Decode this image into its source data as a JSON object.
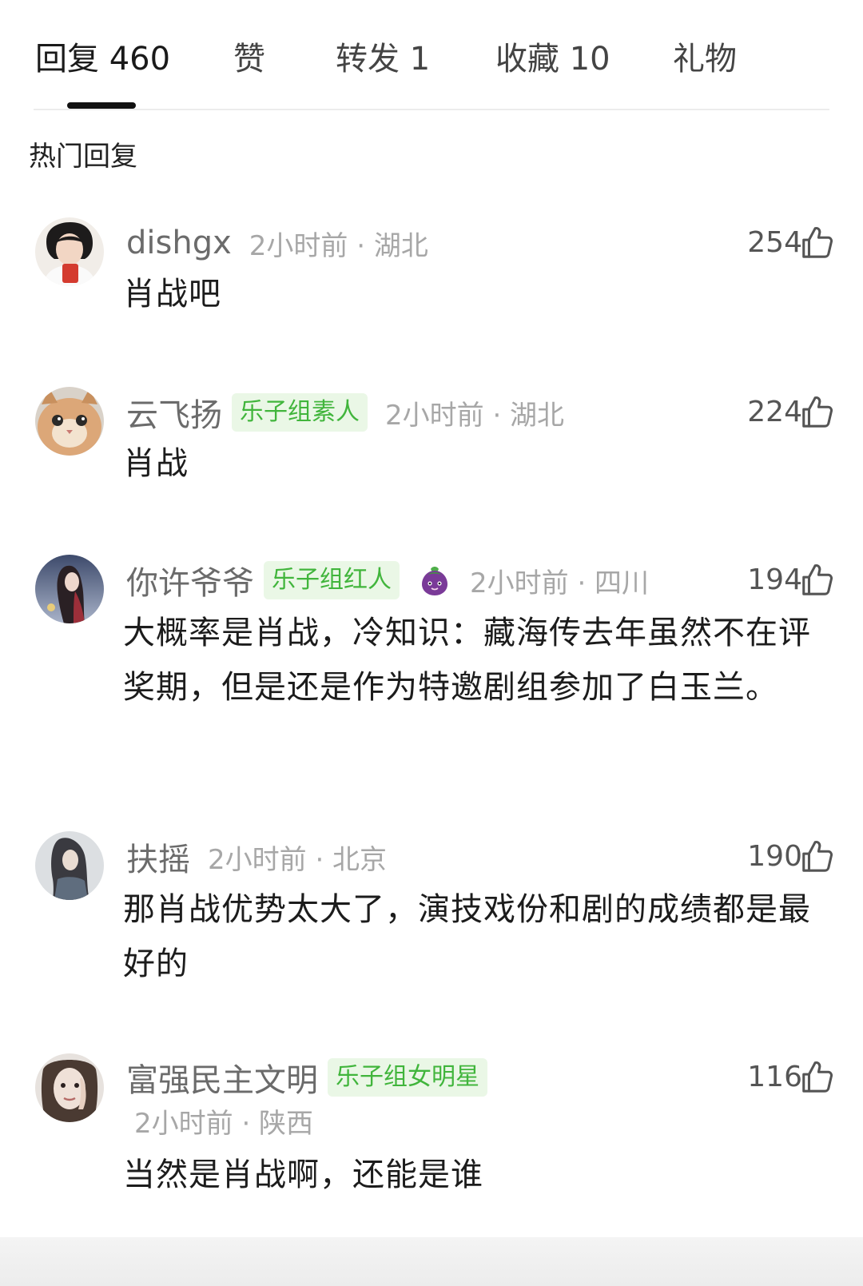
{
  "tabs": [
    {
      "label": "回复 460",
      "active": true
    },
    {
      "label": "赞",
      "active": false
    },
    {
      "label": "转发 1",
      "active": false
    },
    {
      "label": "收藏 10",
      "active": false
    },
    {
      "label": "礼物",
      "active": false
    }
  ],
  "section_title": "热门回复",
  "badge_color": "#41b53c",
  "comments": [
    {
      "username": "dishgx",
      "badge": "",
      "meta": "2小时前 · 湖北",
      "likes": "254",
      "text": "肖战吧"
    },
    {
      "username": "云飞扬",
      "badge": "乐子组素人",
      "meta": "2小时前 · 湖北",
      "likes": "224",
      "text": "肖战"
    },
    {
      "username": "你许爷爷",
      "badge": "乐子组红人",
      "badge_icon": "eggplant-icon",
      "meta": "2小时前 · 四川",
      "likes": "194",
      "text": "大概率是肖战，冷知识：藏海传去年虽然不在评奖期，但是还是作为特邀剧组参加了白玉兰。"
    },
    {
      "username": "扶摇",
      "badge": "",
      "meta": "2小时前 · 北京",
      "likes": "190",
      "text": "那肖战优势太大了，演技戏份和剧的成绩都是最好的"
    },
    {
      "username": "富强民主文明",
      "badge": "乐子组女明星",
      "meta": "2小时前 · 陕西",
      "likes": "116",
      "text": "当然是肖战啊，还能是谁"
    }
  ]
}
